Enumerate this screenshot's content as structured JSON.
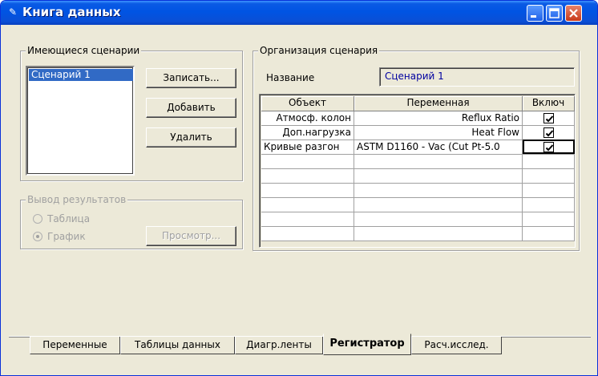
{
  "window": {
    "title": "Книга данных"
  },
  "scenarios": {
    "group_label": "Имеющиеся сценарии",
    "group_label_accel": "с",
    "items": [
      "Сценарий 1"
    ],
    "buttons": {
      "save": "Записать...",
      "add": "Добавить",
      "delete": "Удалить"
    }
  },
  "output": {
    "group_label": "Вывод результатов",
    "options": [
      "Таблица",
      "График"
    ],
    "selected": "График",
    "view_button": "Просмотр..."
  },
  "organization": {
    "group_label": "Организация сценария",
    "name_label": "Название",
    "name_value": "Сценарий 1",
    "table": {
      "headers": [
        "Объект",
        "Переменная",
        "Включ"
      ],
      "rows": [
        {
          "object": "Атмосф. колон",
          "variable": "Reflux Ratio",
          "include": true
        },
        {
          "object": "Доп.нагрузка",
          "variable": "Heat Flow",
          "include": true
        },
        {
          "object": "Кривые разгон",
          "variable": "ASTM D1160 - Vac (Cut Pt-5.0",
          "include": true
        }
      ]
    }
  },
  "tabs": [
    {
      "label": "Переменные",
      "active": false
    },
    {
      "label": "Таблицы данных",
      "active": false
    },
    {
      "label": "Диагр.ленты",
      "active": false
    },
    {
      "label": "Регистратор",
      "active": true
    },
    {
      "label": "Расч.исслед.",
      "active": false
    }
  ],
  "colors": {
    "title_blue": "#0054e3",
    "selection": "#316ac5",
    "field_text": "#0000a0"
  }
}
